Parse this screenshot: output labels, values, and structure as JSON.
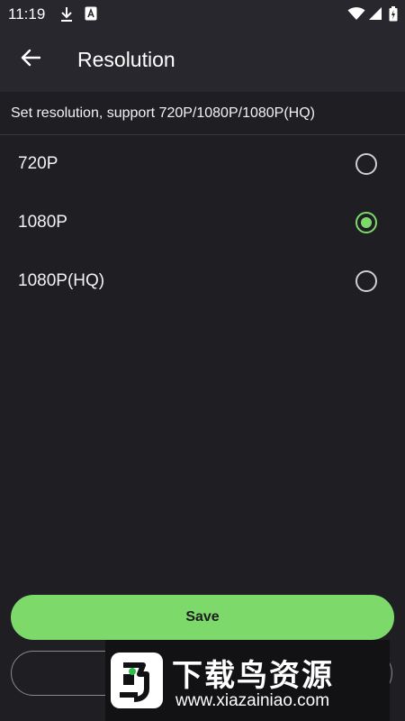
{
  "status_bar": {
    "time": "11:19",
    "icons": [
      "download-icon",
      "a-badge-icon",
      "wifi-icon",
      "signal-icon",
      "battery-icon"
    ]
  },
  "app_bar": {
    "back_icon": "arrow-left-icon",
    "title": "Resolution"
  },
  "hint": "Set resolution, support 720P/1080P/1080P(HQ)",
  "options": [
    {
      "label": "720P",
      "selected": false
    },
    {
      "label": "1080P",
      "selected": true
    },
    {
      "label": "1080P(HQ)",
      "selected": false
    }
  ],
  "buttons": {
    "save_label": "Save",
    "cancel_label": ""
  },
  "watermark": {
    "title": "下载鸟资源",
    "url": "www.xiazainiao.com"
  },
  "colors": {
    "background": "#1f1e23",
    "app_bar": "#28272d",
    "accent": "#7ed96b"
  }
}
